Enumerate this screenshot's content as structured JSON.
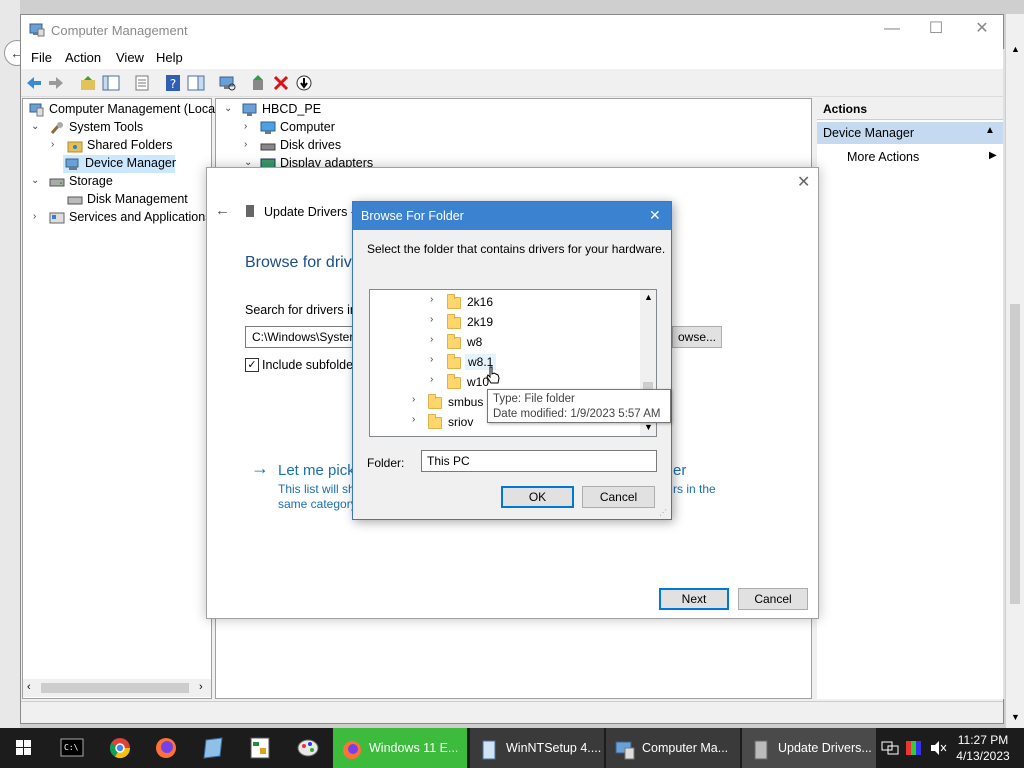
{
  "window": {
    "title": "Computer Management",
    "minimize": "—",
    "maximize": "☐",
    "close": "✕"
  },
  "menu": [
    "File",
    "Action",
    "View",
    "Help"
  ],
  "left_tree": [
    {
      "label": "Computer Management (Local",
      "level": 0,
      "chev": ""
    },
    {
      "label": "System Tools",
      "level": 1,
      "chev": "open"
    },
    {
      "label": "Shared Folders",
      "level": 2,
      "chev": "closed"
    },
    {
      "label": "Device Manager",
      "level": 2,
      "chev": "",
      "selected": true
    },
    {
      "label": "Storage",
      "level": 1,
      "chev": "open"
    },
    {
      "label": "Disk Management",
      "level": 2,
      "chev": ""
    },
    {
      "label": "Services and Applications",
      "level": 1,
      "chev": "closed"
    }
  ],
  "device_tree": [
    {
      "label": "HBCD_PE",
      "chev": "open",
      "level": 0
    },
    {
      "label": "Computer",
      "chev": "closed",
      "level": 1
    },
    {
      "label": "Disk drives",
      "chev": "closed",
      "level": 1
    },
    {
      "label": "Display adapters",
      "chev": "open",
      "level": 1
    }
  ],
  "actions": {
    "header": "Actions",
    "section": "Device Manager",
    "more": "More Actions"
  },
  "update_dialog": {
    "title": "Update Drivers -",
    "heading": "Browse for driv",
    "search_label": "Search for drivers in",
    "path_value": "C:\\Windows\\Syster",
    "browse": "owse...",
    "include_sub": "Include subfolder",
    "let_me": "Let me pick",
    "let_me_tail": "er",
    "desc1": "This list will sh",
    "desc1_tail": "rs in the",
    "desc2": "same category",
    "next": "Next",
    "cancel": "Cancel"
  },
  "browse_dialog": {
    "title": "Browse For Folder",
    "instruction": "Select the folder that contains drivers for your hardware.",
    "folders": [
      {
        "label": "2k16",
        "level": 1
      },
      {
        "label": "2k19",
        "level": 1
      },
      {
        "label": "w8",
        "level": 1
      },
      {
        "label": "w8.1",
        "level": 1,
        "hover": true
      },
      {
        "label": "w10",
        "level": 1
      },
      {
        "label": "smbus",
        "level": 0
      },
      {
        "label": "sriov",
        "level": 0
      }
    ],
    "tooltip_type": "Type: File folder",
    "tooltip_date": "Date modified: 1/9/2023 5:57 AM",
    "folder_label": "Folder:",
    "folder_value": "This PC",
    "ok": "OK",
    "cancel": "Cancel"
  },
  "taskbar": {
    "tasks": [
      {
        "label": "Windows 11 E...",
        "icon": "firefox-icon",
        "bg": "#3dbb3d"
      },
      {
        "label": "WinNTSetup 4....",
        "icon": "setup-icon",
        "bg": "#3a3a3a"
      },
      {
        "label": "Computer Ma...",
        "icon": "computer-management-icon",
        "bg": "#3a3a3a"
      },
      {
        "label": "Update Drivers...",
        "icon": "update-drivers-icon",
        "bg": "#4a4a4a"
      }
    ],
    "time": "11:27 PM",
    "date": "4/13/2023"
  },
  "colors": {
    "accent": "#0078d7",
    "dialog_title": "#3b82d0",
    "link": "#1a6fb5",
    "taskbar": "#1c1c1c",
    "active_task": "#3dbb3d"
  }
}
